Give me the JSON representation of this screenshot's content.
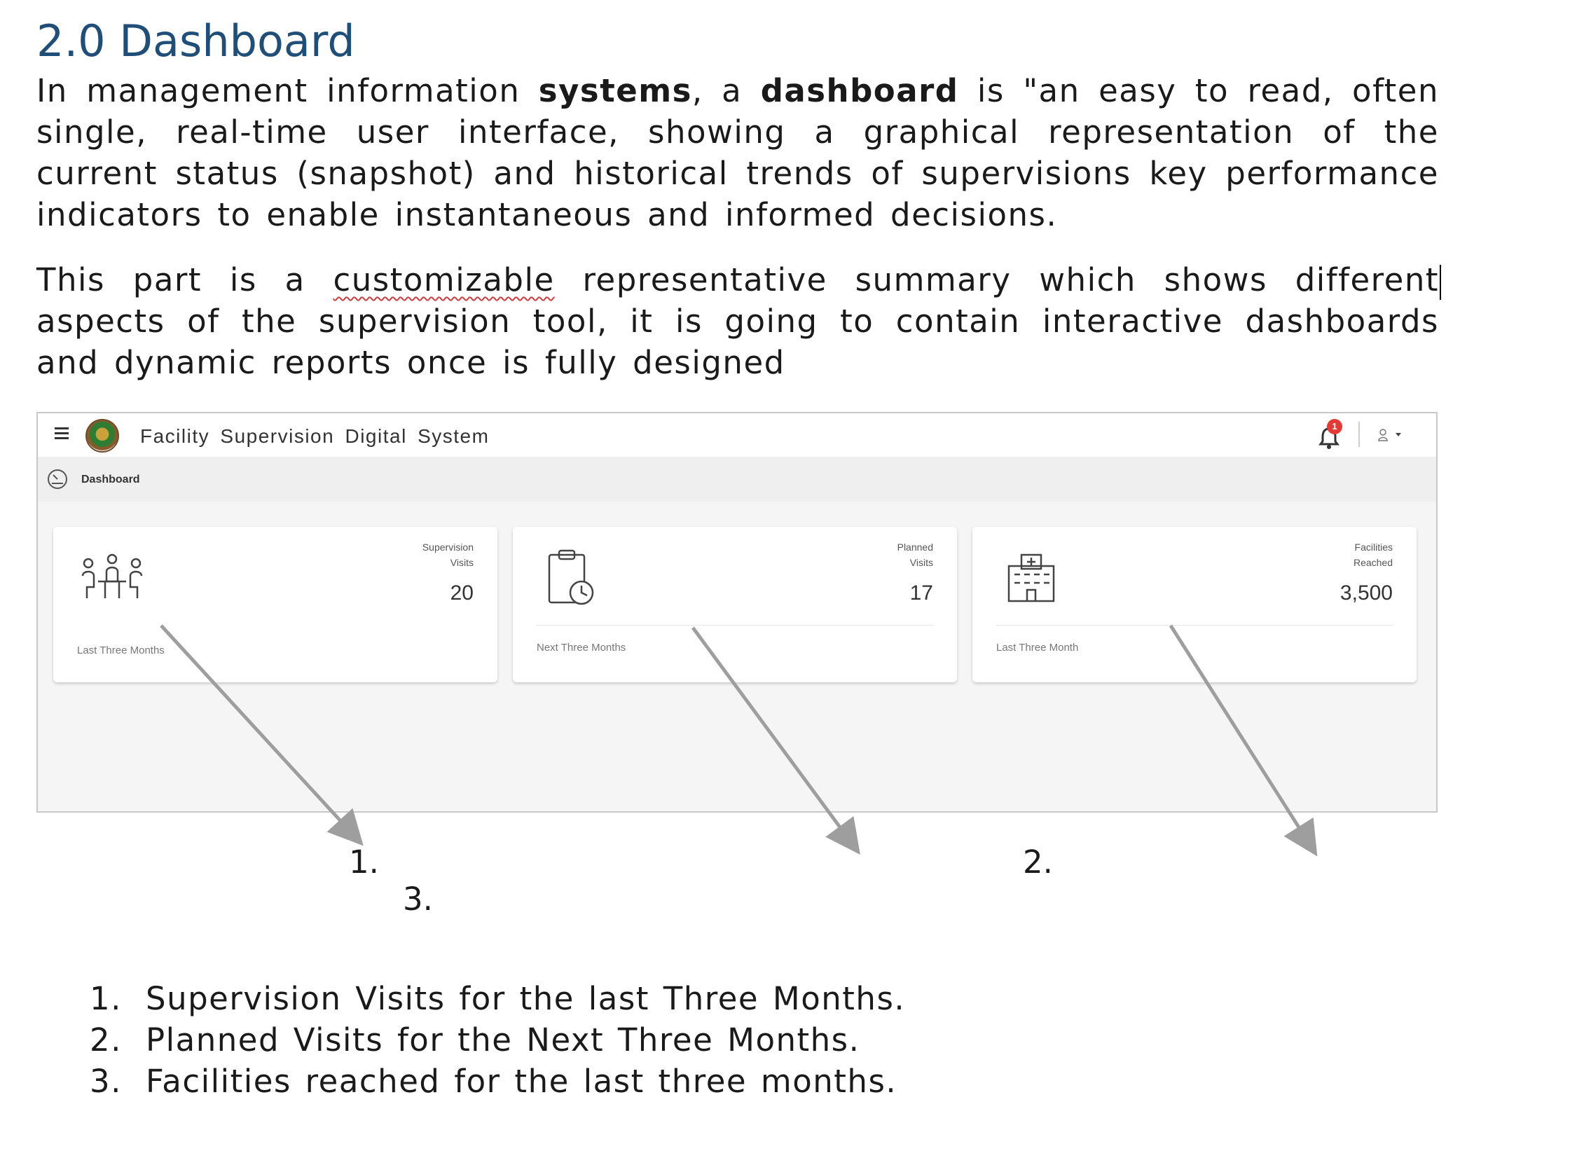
{
  "heading": "2.0 Dashboard",
  "intro": {
    "part1": "In management information ",
    "bold1": "systems",
    "part2": ", a ",
    "bold2": "dashboard",
    "part3": " is \"an easy to read, often single, real-time user interface, showing a graphical representation of the current status (snapshot) and historical trends of supervisions key performance indicators to enable instantaneous and informed decisions."
  },
  "summary": {
    "before": "This part is a ",
    "misspelled": "customizable",
    "after": " representative summary which shows different aspects of the supervision tool, it is going to contain interactive dashboards and dynamic reports once is fully designed"
  },
  "screenshot": {
    "app_title": "Facility Supervision Digital System",
    "notification_count": "1",
    "breadcrumb": "Dashboard",
    "icons": {
      "menu": "hamburger-icon",
      "logo": "coat-of-arms-logo",
      "notification": "bell-icon",
      "user": "user-icon",
      "breadcrumb": "gauge-icon"
    },
    "cards": [
      {
        "label_line1": "Supervision",
        "label_line2": "Visits",
        "value": "20",
        "footer": "Last Three Months",
        "icon": "meeting-people-icon"
      },
      {
        "label_line1": "Planned",
        "label_line2": "Visits",
        "value": "17",
        "footer": "Next Three Months",
        "icon": "clipboard-clock-icon"
      },
      {
        "label_line1": "Facilities",
        "label_line2": "Reached",
        "value": "3,500",
        "footer": "Last Three Month",
        "icon": "hospital-building-icon"
      }
    ]
  },
  "callouts": [
    "1.",
    "3.",
    "2."
  ],
  "list": [
    {
      "num": "1.",
      "text": "Supervision Visits for the last Three Months."
    },
    {
      "num": "2.",
      "text": "Planned Visits for the Next Three Months."
    },
    {
      "num": "3.",
      "text": "Facilities reached for the last three months."
    }
  ],
  "colors": {
    "heading": "#1f4e79",
    "badge": "#e53935",
    "arrow": "#9e9e9e",
    "spellcheck": "#d23c3c"
  }
}
